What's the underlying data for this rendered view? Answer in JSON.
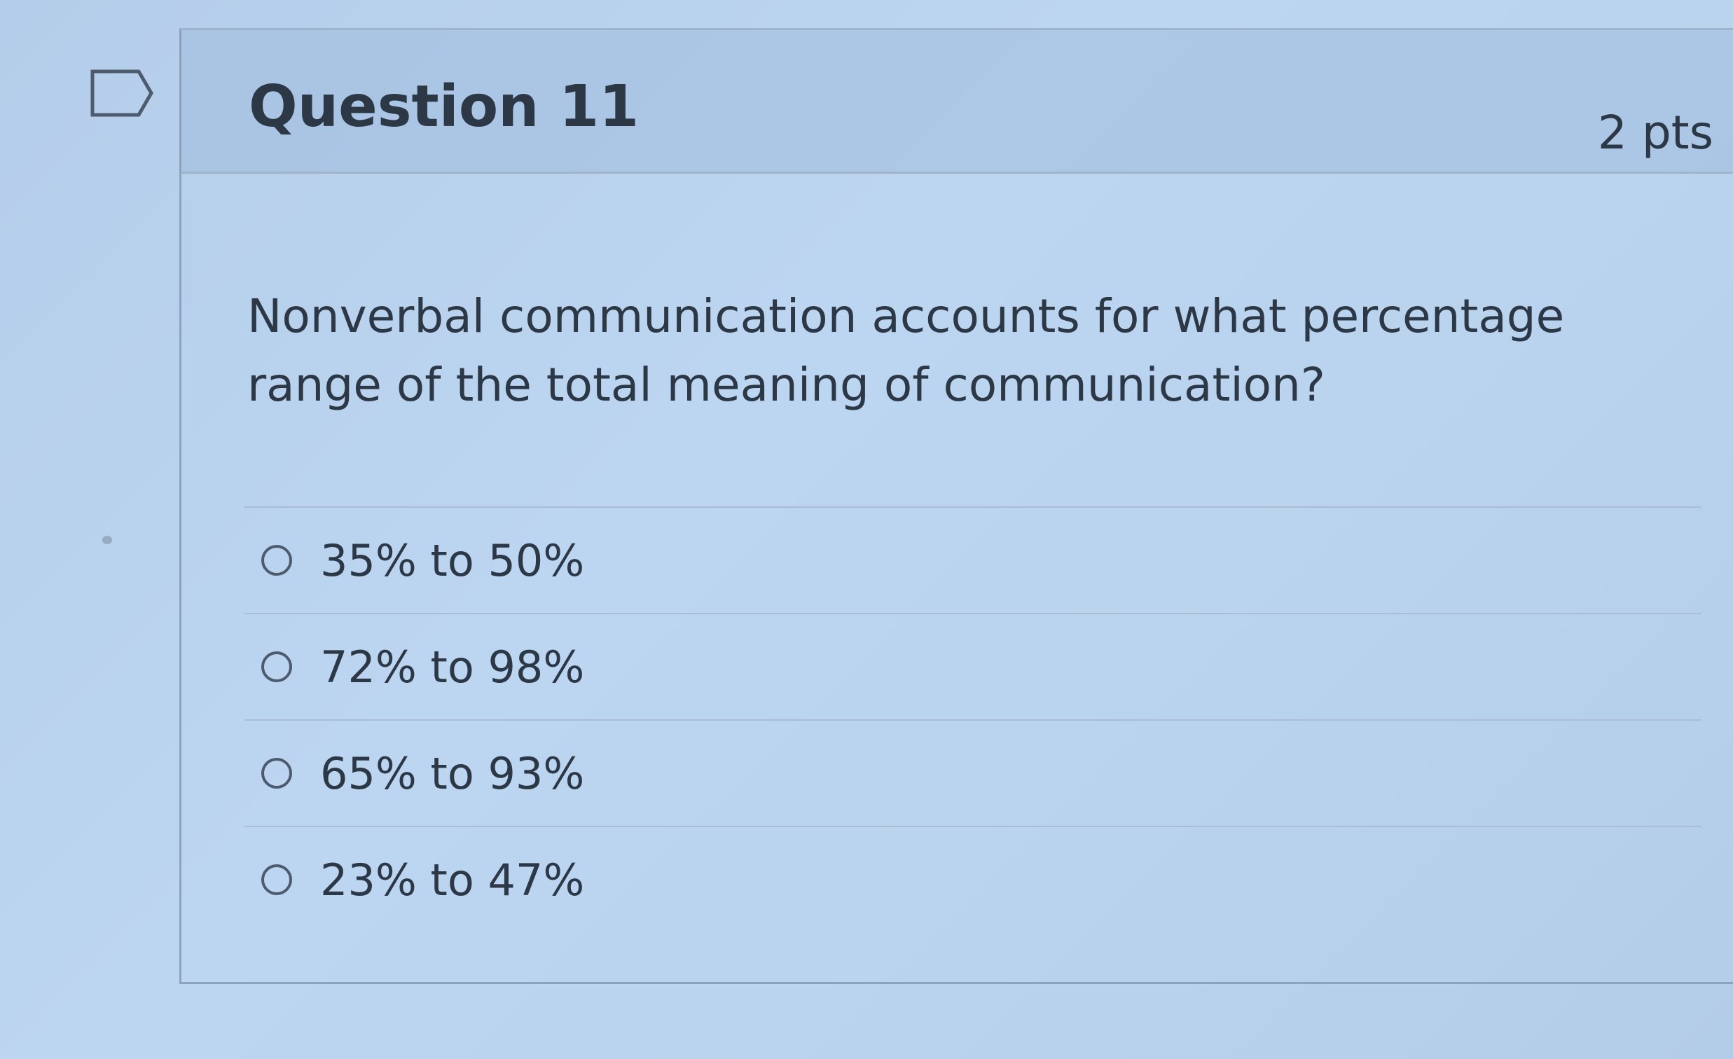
{
  "question": {
    "title": "Question 11",
    "points": "2 pts",
    "text": "Nonverbal communication accounts for what percentage range of the total meaning of communication?",
    "flag_icon": "flag-outline-icon"
  },
  "answers": [
    {
      "label": "35% to 50%"
    },
    {
      "label": "72% to 98%"
    },
    {
      "label": "65% to 93%"
    },
    {
      "label": "23% to 47%"
    }
  ],
  "colors": {
    "background": "#b9d3ee",
    "text": "#2d3847",
    "border": "#8ea2bb"
  }
}
